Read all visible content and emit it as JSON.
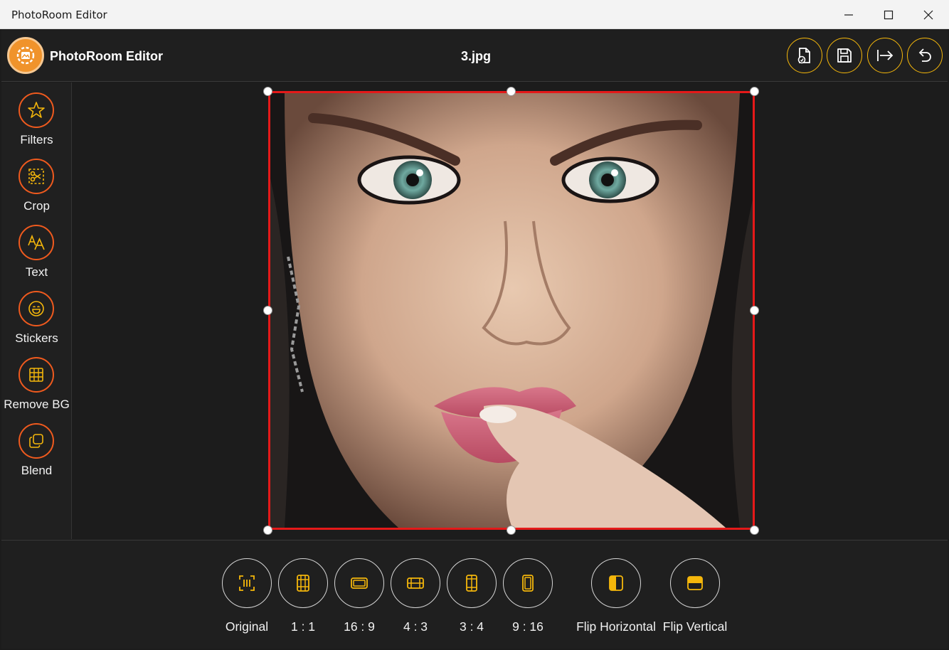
{
  "window": {
    "title": "PhotoRoom Editor",
    "minimize_icon": "minimize-icon",
    "maximize_icon": "maximize-icon",
    "close_icon": "close-icon"
  },
  "header": {
    "app_name": "PhotoRoom Editor",
    "file_name": "3.jpg",
    "actions": [
      {
        "name": "save-as-button",
        "icon": "file-save-icon"
      },
      {
        "name": "save-button",
        "icon": "floppy-disk-icon"
      },
      {
        "name": "export-button",
        "icon": "arrow-right-bar-icon"
      },
      {
        "name": "undo-button",
        "icon": "undo-icon"
      }
    ]
  },
  "sidebar": {
    "items": [
      {
        "label": "Filters",
        "icon": "star-icon"
      },
      {
        "label": "Crop",
        "icon": "crop-scissors-icon"
      },
      {
        "label": "Text",
        "icon": "text-aa-icon"
      },
      {
        "label": "Stickers",
        "icon": "smiley-icon"
      },
      {
        "label": "Remove BG",
        "icon": "grid-icon"
      },
      {
        "label": "Blend",
        "icon": "layers-copy-icon"
      }
    ]
  },
  "canvas": {
    "image_alt": "Portrait photo of a woman with green eyes and pink lips"
  },
  "crop_options": [
    {
      "label": "Original",
      "icon": "crop-original-icon"
    },
    {
      "label": "1 : 1",
      "icon": "crop-1-1-icon"
    },
    {
      "label": "16 : 9",
      "icon": "crop-16-9-icon"
    },
    {
      "label": "4 : 3",
      "icon": "crop-4-3-icon"
    },
    {
      "label": "3 : 4",
      "icon": "crop-3-4-icon"
    },
    {
      "label": "9 : 16",
      "icon": "crop-9-16-icon"
    },
    {
      "label": "Flip Horizontal",
      "icon": "flip-horizontal-icon"
    },
    {
      "label": "Flip Vertical",
      "icon": "flip-vertical-icon"
    }
  ],
  "colors": {
    "accent_orange": "#ef5a1e",
    "accent_yellow": "#f5b70b",
    "crop_border": "#e51919",
    "background": "#1c1c1c"
  }
}
